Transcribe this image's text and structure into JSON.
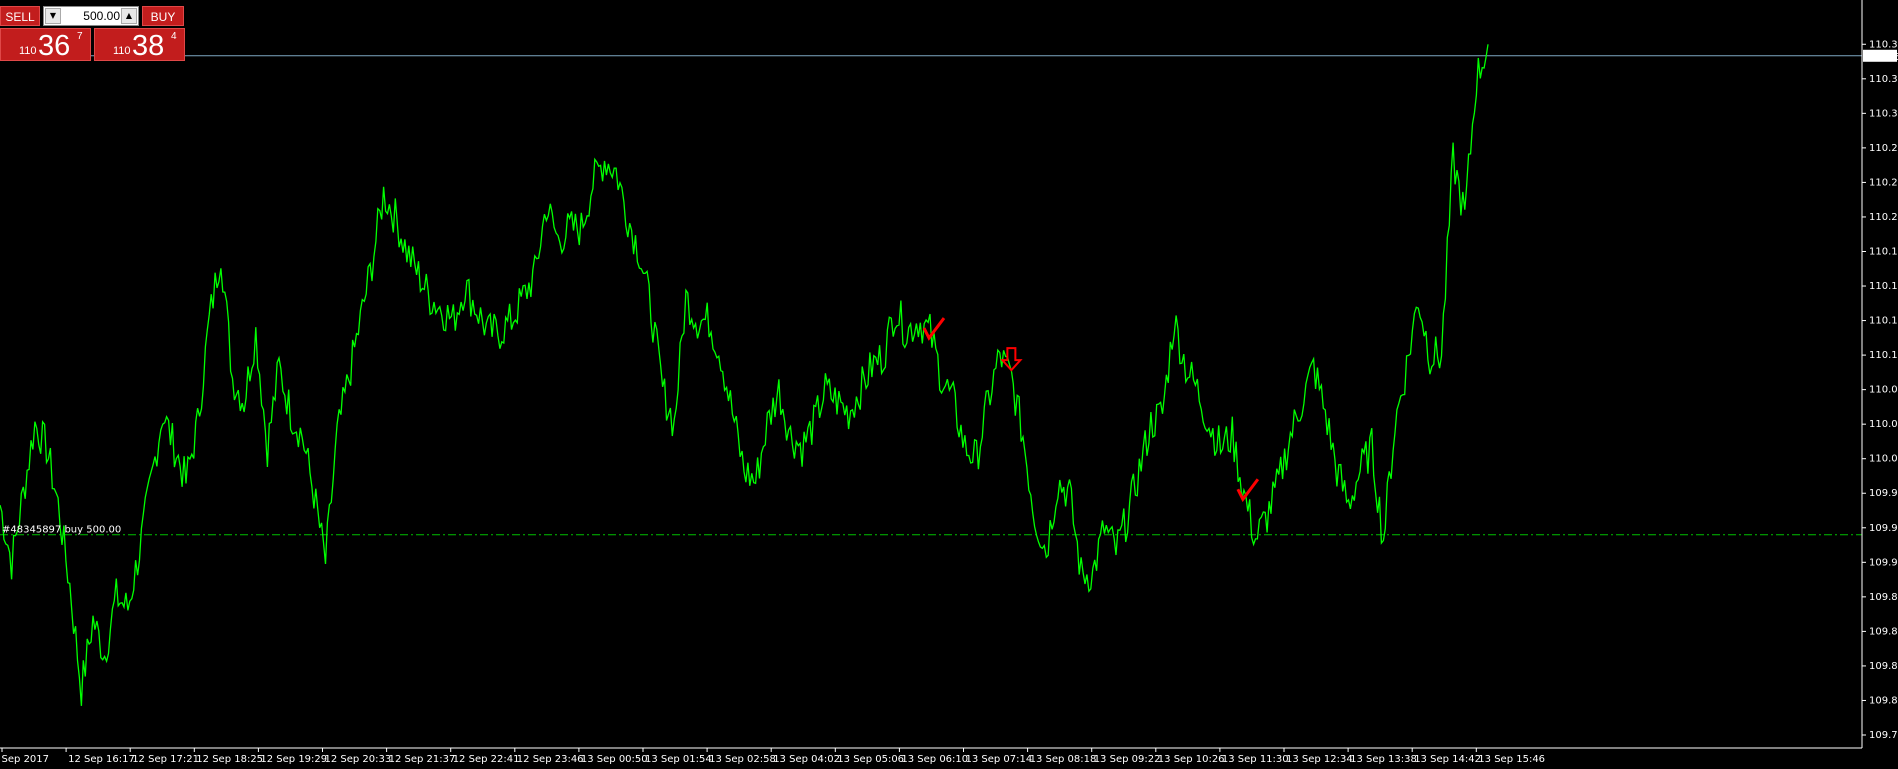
{
  "trade_panel": {
    "sell_label": "SELL",
    "buy_label": "BUY",
    "lot_value": "500.00",
    "lot_down_icon": "▼",
    "lot_up_icon": "▲",
    "sell_price": {
      "small": "110",
      "big": "36",
      "sup": "7"
    },
    "buy_price": {
      "small": "110",
      "big": "38",
      "sup": "4"
    }
  },
  "order_line_label": "#48345897 buy 500.00",
  "colors": {
    "background": "#000000",
    "price_series": "#00ff00",
    "order_line": "#00c000",
    "bid_line": "#7ea7c2",
    "signal": "#ff0000",
    "panel": "#c21d1d"
  },
  "chart_data": {
    "type": "line",
    "symbol_hint": "USDJPY",
    "current_price_label": "110.36",
    "order_price": 109.944,
    "ylim": [
      109.77,
      110.385
    ],
    "y_ticks": [
      "110.37",
      "110.34",
      "110.31",
      "110.28",
      "110.25",
      "110.22",
      "110.19",
      "110.16",
      "110.13",
      "110.10",
      "110.07",
      "110.04",
      "110.01",
      "109.98",
      "109.95",
      "109.92",
      "109.89",
      "109.86",
      "109.83",
      "109.80",
      "109.77"
    ],
    "x_ticks": [
      "2 Sep 2017",
      "12 Sep 16:17",
      "12 Sep 17:21",
      "12 Sep 18:25",
      "12 Sep 19:29",
      "12 Sep 20:33",
      "12 Sep 21:37",
      "12 Sep 22:41",
      "12 Sep 23:46",
      "13 Sep 00:50",
      "13 Sep 01:54",
      "13 Sep 02:58",
      "13 Sep 04:02",
      "13 Sep 05:06",
      "13 Sep 06:10",
      "13 Sep 07:14",
      "13 Sep 08:18",
      "13 Sep 09:22",
      "13 Sep 10:26",
      "13 Sep 11:30",
      "13 Sep 12:34",
      "13 Sep 13:38",
      "13 Sep 14:42",
      "13 Sep 15:46"
    ],
    "series": [
      {
        "values": [
          109.97,
          109.92,
          109.98,
          110.04,
          110.02,
          109.97,
          109.9,
          109.81,
          109.87,
          109.84,
          109.89,
          109.88,
          109.93,
          109.99,
          110.05,
          110.02,
          109.99,
          110.04,
          110.13,
          110.19,
          110.08,
          110.06,
          110.12,
          110.02,
          110.09,
          110.05,
          110.03,
          109.98,
          109.92,
          110.03,
          110.08,
          110.13,
          110.18,
          110.24,
          110.22,
          110.19,
          110.17,
          110.15,
          110.14,
          110.13,
          110.16,
          110.14,
          110.12,
          110.12,
          110.13,
          110.15,
          110.17,
          110.23,
          110.2,
          110.21,
          110.21,
          110.25,
          110.27,
          110.26,
          110.22,
          110.19,
          110.14,
          110.07,
          110.04,
          110.15,
          110.13,
          110.13,
          110.1,
          110.05,
          110.0,
          109.99,
          110.04,
          110.07,
          110.03,
          110.02,
          110.04,
          110.07,
          110.06,
          110.05,
          110.07,
          110.09,
          110.1,
          110.14,
          110.12,
          110.13,
          110.12,
          110.08,
          110.06,
          110.02,
          110.01,
          110.06,
          110.1,
          110.08,
          110.03,
          109.96,
          109.93,
          109.99,
          109.98,
          109.91,
          109.91,
          109.95,
          109.93,
          109.96,
          110.0,
          110.04,
          110.05,
          110.13,
          110.09,
          110.07,
          110.04,
          110.02,
          110.03,
          109.98,
          109.94,
          109.96,
          109.99,
          110.03,
          110.06,
          110.09,
          110.05,
          110.0,
          109.97,
          110.0,
          110.02,
          109.94,
          110.04,
          110.09,
          110.15,
          110.1,
          110.1,
          110.27,
          110.22,
          110.34,
          110.37
        ]
      }
    ],
    "markers": [
      {
        "shape": "down-arrow",
        "at_index": 87
      },
      {
        "shape": "check",
        "at_index": 80
      },
      {
        "shape": "check",
        "at_index": 107
      },
      {
        "shape": "up-arrow",
        "at_index": 138
      }
    ]
  }
}
